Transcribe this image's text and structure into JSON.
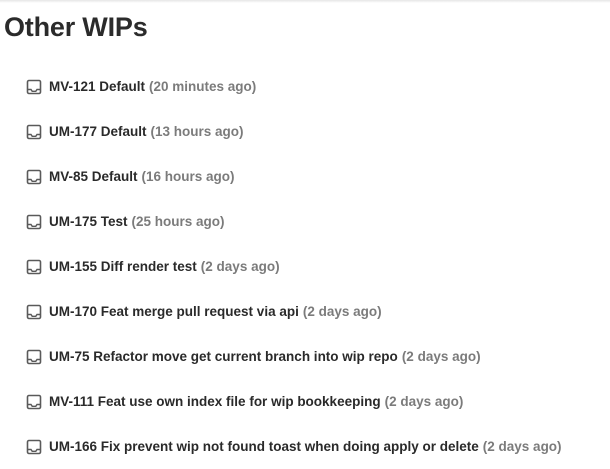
{
  "header": {
    "title": "Other WIPs"
  },
  "wips": [
    {
      "name": "MV-121 Default",
      "time": "(20 minutes ago)"
    },
    {
      "name": "UM-177 Default",
      "time": "(13 hours ago)"
    },
    {
      "name": "MV-85 Default",
      "time": "(16 hours ago)"
    },
    {
      "name": "UM-175 Test",
      "time": "(25 hours ago)"
    },
    {
      "name": "UM-155 Diff render test",
      "time": "(2 days ago)"
    },
    {
      "name": "UM-170 Feat merge pull request via api",
      "time": "(2 days ago)"
    },
    {
      "name": "UM-75 Refactor move get current branch into wip repo",
      "time": "(2 days ago)"
    },
    {
      "name": "MV-111 Feat use own index file for wip bookkeeping",
      "time": "(2 days ago)"
    },
    {
      "name": "UM-166 Fix prevent wip not found toast when doing apply or delete",
      "time": "(2 days ago)"
    }
  ],
  "icons": {
    "wip_item_icon": "inbox-tray-icon"
  },
  "colors": {
    "title": "#2b2b2b",
    "item_text": "#2a2a2a",
    "time_text": "#7b7b7b",
    "icon": "#5a5a5a"
  }
}
